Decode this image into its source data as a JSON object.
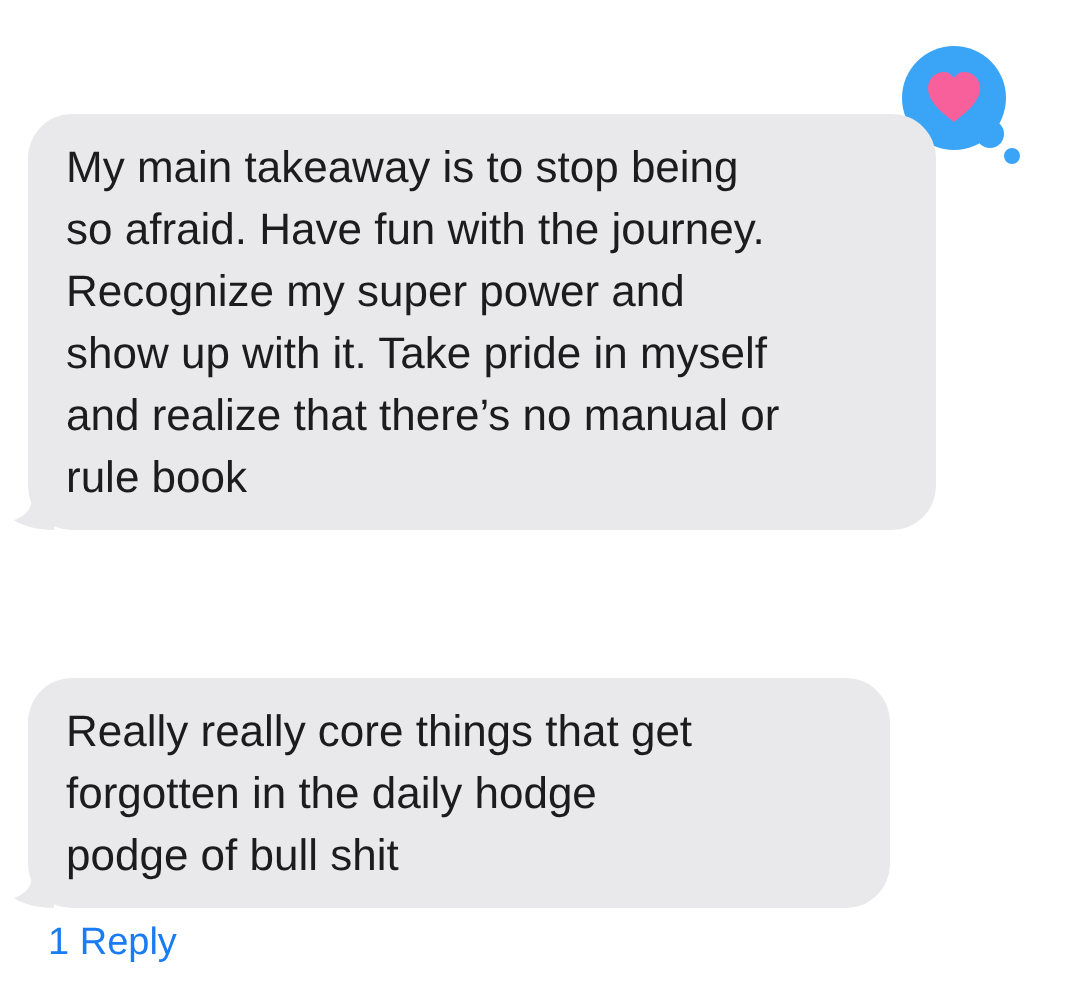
{
  "messages": [
    {
      "text": "My main takeaway is to stop being so afraid. Have fun with the journey. Recognize my super power and show up with it. Take pride in myself and realize that there’s no manual or rule book",
      "tapback": {
        "kind": "heart"
      }
    },
    {
      "text": "Really really core things that get forgotten in the daily hodge podge of bull shit",
      "reply_link": "1 Reply"
    }
  ]
}
